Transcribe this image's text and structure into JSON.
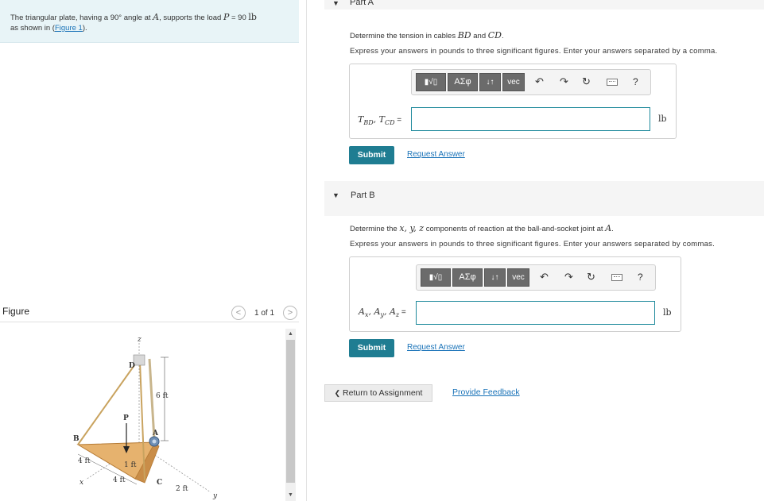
{
  "problem": {
    "text_before_angle": "The triangular plate, having a ",
    "angle_value": "90°",
    "text_after_angle": " angle at ",
    "point_a": "A",
    "text_supports": ", supports the load ",
    "load_symbol": "P",
    "load_equals": " = 90 ",
    "load_unit": "lb",
    "line2_prefix": "as shown in (",
    "figure_link": "Figure 1",
    "line2_suffix": ")."
  },
  "figure": {
    "label": "Figure",
    "prev_icon": "<",
    "counter": "1 of 1",
    "next_icon": ">",
    "scroll_up_icon": "▲",
    "scroll_down_icon": "▼",
    "labels": {
      "z": "z",
      "D": "D",
      "height": "6 ft",
      "P": "P",
      "B": "B",
      "A": "A",
      "left_4ft": "4 ft",
      "one_ft": "1 ft",
      "lower_4ft": "4 ft",
      "C": "C",
      "two_ft": "2 ft",
      "x": "x",
      "y": "y"
    },
    "colors": {
      "plate": "#e6b26e",
      "plate_edge": "#b57a34",
      "cable": "#c9a35f",
      "pole": "#c8b58c"
    }
  },
  "partA": {
    "caret": "▼",
    "title": "Part A",
    "question_prefix": "Determine the tension in cables ",
    "cable1": "BD",
    "question_and": " and ",
    "cable2": "CD",
    "question_suffix": ".",
    "instruction": "Express your answers in pounds to three significant figures. Enter your answers separated by a comma.",
    "answer_label": "T",
    "answer_sub1": "BD",
    "answer_sep": ", T",
    "answer_sub2": "CD",
    "answer_eq": " =",
    "input_value": "",
    "unit": "lb",
    "submit": "Submit",
    "request": "Request Answer"
  },
  "partB": {
    "caret": "▼",
    "title": "Part B",
    "question_prefix": "Determine the ",
    "components": "x, y, z",
    "question_mid": " components of reaction at the ball-and-socket joint at ",
    "point": "A",
    "question_suffix": ".",
    "instruction": "Express your answers in pounds to three significant figures. Enter your answers separated by commas.",
    "answer_label": "A",
    "sub_x": "x",
    "sub_y": "y",
    "sub_z": "z",
    "input_value": "",
    "unit": "lb",
    "submit": "Submit",
    "request": "Request Answer"
  },
  "toolbar": {
    "templates": "▮√▯",
    "greek": "ΑΣφ",
    "updown": "↓↑",
    "vec": "vec",
    "undo": "↶",
    "redo": "↷",
    "reset": "↻",
    "help": "?"
  },
  "footer": {
    "return_label": "Return to Assignment",
    "return_icon": "❮",
    "feedback_label": "Provide Feedback"
  }
}
